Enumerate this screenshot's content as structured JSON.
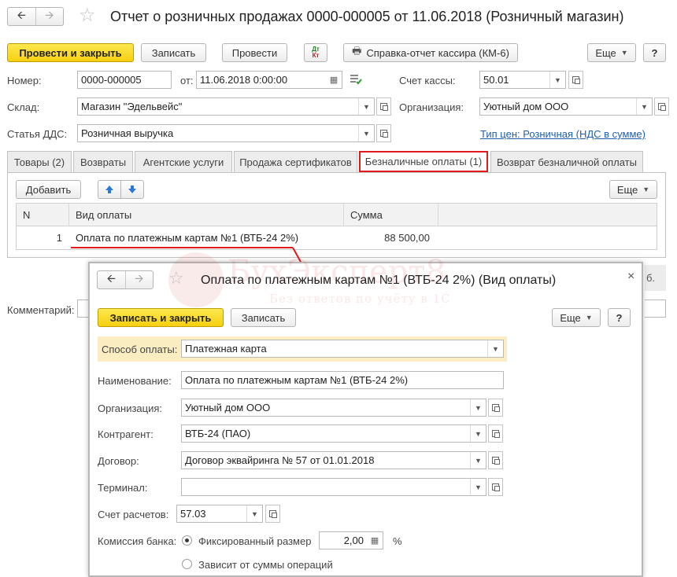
{
  "window": {
    "title": "Отчет о розничных продажах 0000-000005 от 11.06.2018 (Розничный магазин)"
  },
  "toolbar": {
    "post_close": "Провести и закрыть",
    "save": "Записать",
    "post": "Провести",
    "dtkt_top": "Дт",
    "dtkt_bottom": "Кт",
    "cashier_report": "Справка-отчет кассира (КМ-6)",
    "more": "Еще",
    "help": "?"
  },
  "form": {
    "number_label": "Номер:",
    "number": "0000-000005",
    "date_label": "от:",
    "date": "11.06.2018  0:00:00",
    "cash_account_label": "Счет кассы:",
    "cash_account": "50.01",
    "warehouse_label": "Склад:",
    "warehouse": "Магазин \"Эдельвейс\"",
    "organization_label": "Организация:",
    "organization": "Уютный дом ООО",
    "dds_label": "Статья ДДС:",
    "dds": "Розничная выручка",
    "price_type_link": "Тип цен: Розничная (НДС в сумме)",
    "comment_label": "Комментарий:"
  },
  "tabs": [
    {
      "label": "Товары (2)"
    },
    {
      "label": "Возвраты"
    },
    {
      "label": "Агентские услуги"
    },
    {
      "label": "Продажа сертификатов"
    },
    {
      "label": "Безналичные оплаты (1)"
    },
    {
      "label": "Возврат безналичной оплаты"
    }
  ],
  "table_toolbar": {
    "add": "Добавить",
    "more": "Еще"
  },
  "table": {
    "columns": [
      "N",
      "Вид оплаты",
      "Сумма"
    ],
    "rows": [
      {
        "n": "1",
        "payment_type": "Оплата по платежным картам №1 (ВТБ-24 2%)",
        "sum": "88 500,00"
      }
    ]
  },
  "partial": {
    "right_fragment": "б."
  },
  "watermark": {
    "title": "БухЭксперт8",
    "subtitle": "Без ответов по учёту в 1С"
  },
  "dialog": {
    "title": "Оплата по платежным картам №1 (ВТБ-24 2%) (Вид оплаты)",
    "save_close": "Записать и закрыть",
    "save": "Записать",
    "more": "Еще",
    "help": "?",
    "close": "×",
    "payment_method_label": "Способ оплаты:",
    "payment_method": "Платежная карта",
    "name_label": "Наименование:",
    "name": "Оплата по платежным картам №1 (ВТБ-24 2%)",
    "organization_label": "Организация:",
    "organization": "Уютный дом ООО",
    "counterparty_label": "Контрагент:",
    "counterparty": "ВТБ-24 (ПАО)",
    "contract_label": "Договор:",
    "contract": "Договор эквайринга № 57 от 01.01.2018",
    "terminal_label": "Терминал:",
    "terminal": "",
    "account_label": "Счет расчетов:",
    "account": "57.03",
    "commission_label": "Комиссия банка:",
    "fixed_label": "Фиксированный размер",
    "fixed_value": "2,00",
    "percent": "%",
    "depends_label": "Зависит от суммы операций"
  },
  "colors": {
    "primary_yellow": "#f6cf10",
    "highlight_red": "#e0191b",
    "link_blue": "#1f5fb0",
    "field_highlight": "#fbedc2"
  }
}
